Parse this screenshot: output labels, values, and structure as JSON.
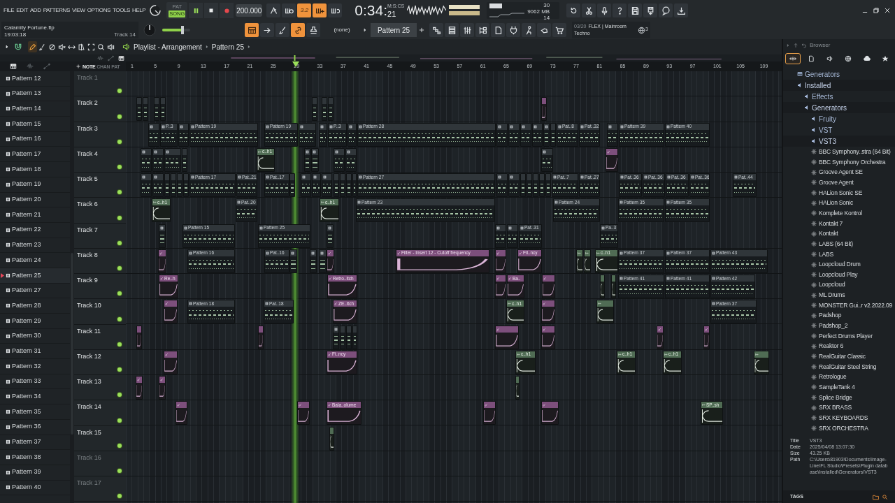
{
  "menu": [
    "FILE",
    "EDIT",
    "ADD",
    "PATTERNS",
    "VIEW",
    "OPTIONS",
    "TOOLS",
    "HELP"
  ],
  "transport": {
    "pattern_label": "PAT",
    "song_label": "SONG",
    "song_mode": true,
    "playing": true,
    "tempo": "200.000",
    "time": "0:34:",
    "centiseconds": "21",
    "time_unit": "M:S:CS"
  },
  "record_options": [
    {
      "kind": "metronome",
      "on": false
    },
    {
      "kind": "wait",
      "on": false
    },
    {
      "kind": "countdown",
      "label": "3.2",
      "on": true
    },
    {
      "kind": "overdub",
      "on": true
    },
    {
      "kind": "loop",
      "on": false
    }
  ],
  "monitor": {
    "cpu": "30",
    "memory": "9062 MB",
    "polyphony": "14"
  },
  "project": {
    "file": "Calamity Fortune.flp",
    "time": "19:03:18",
    "hint": "Track 14"
  },
  "main_volume": {
    "level": 0.72
  },
  "edit_buttons": [
    {
      "kind": "playlist",
      "on": true
    },
    {
      "kind": "arrow",
      "on": false
    },
    {
      "kind": "brush",
      "on": false
    },
    {
      "kind": "link",
      "on": true
    },
    {
      "kind": "stamp",
      "on": false
    }
  ],
  "snap": "(none)",
  "pattern_selector": "Pattern 25",
  "news": {
    "counter": "03/20",
    "title": "FLEX | Mainroom",
    "subtitle": "Techno",
    "badge": "3"
  },
  "playlist_tools": [
    {
      "kind": "pencil",
      "selected": true
    },
    {
      "kind": "brush",
      "selected": false
    },
    {
      "kind": "delete",
      "selected": false
    },
    {
      "kind": "mute",
      "selected": false
    },
    {
      "kind": "slip",
      "selected": false
    },
    {
      "kind": "slice",
      "selected": false
    },
    {
      "kind": "select",
      "selected": false
    },
    {
      "kind": "zoom",
      "selected": false
    },
    {
      "kind": "playback",
      "selected": false
    }
  ],
  "breadcrumb": [
    "Playlist - Arrangement",
    "Pattern 25"
  ],
  "picker": {
    "tabs": [
      {
        "label": "NOTE",
        "selected": true
      },
      {
        "label": "CHAN",
        "selected": false
      },
      {
        "label": "PAT",
        "selected": false
      }
    ],
    "patterns": [
      {
        "name": "Pattern 12",
        "selected": false
      },
      {
        "name": "Pattern 13",
        "selected": false
      },
      {
        "name": "Pattern 14",
        "selected": false
      },
      {
        "name": "Pattern 15",
        "selected": false
      },
      {
        "name": "Pattern 16",
        "selected": false
      },
      {
        "name": "Pattern 17",
        "selected": false
      },
      {
        "name": "Pattern 18",
        "selected": false
      },
      {
        "name": "Pattern 19",
        "selected": false
      },
      {
        "name": "Pattern 20",
        "selected": false
      },
      {
        "name": "Pattern 21",
        "selected": false
      },
      {
        "name": "Pattern 22",
        "selected": false
      },
      {
        "name": "Pattern 23",
        "selected": false
      },
      {
        "name": "Pattern 24",
        "selected": false
      },
      {
        "name": "Pattern 25",
        "selected": true
      },
      {
        "name": "Pattern 27",
        "selected": false
      },
      {
        "name": "Pattern 28",
        "selected": false
      },
      {
        "name": "Pattern 29",
        "selected": false
      },
      {
        "name": "Pattern 30",
        "selected": false
      },
      {
        "name": "Pattern 31",
        "selected": false
      },
      {
        "name": "Pattern 32",
        "selected": false
      },
      {
        "name": "Pattern 33",
        "selected": false
      },
      {
        "name": "Pattern 34",
        "selected": false
      },
      {
        "name": "Pattern 35",
        "selected": false
      },
      {
        "name": "Pattern 36",
        "selected": false
      },
      {
        "name": "Pattern 37",
        "selected": false
      },
      {
        "name": "Pattern 38",
        "selected": false
      },
      {
        "name": "Pattern 39",
        "selected": false
      },
      {
        "name": "Pattern 40",
        "selected": false
      }
    ]
  },
  "ruler": [
    "1",
    "5",
    "9",
    "13",
    "17",
    "21",
    "25",
    "29",
    "33",
    "37",
    "41",
    "45",
    "49",
    "53",
    "57",
    "61",
    "65",
    "69",
    "73",
    "77",
    "81",
    "85",
    "89",
    "93",
    "97",
    "101",
    "105",
    "109"
  ],
  "tracks": [
    {
      "name": "Track 1",
      "empty": true,
      "muted": false
    },
    {
      "name": "Track 2",
      "empty": false,
      "muted": false,
      "clips": [
        {
          "kind": "pattern"
        },
        {
          "kind": "pattern"
        },
        {
          "kind": "pattern"
        },
        {
          "kind": "pattern"
        },
        {
          "kind": "pattern"
        },
        {
          "kind": "pattern"
        },
        {
          "kind": "pattern"
        },
        {
          "kind": "automation"
        }
      ]
    },
    {
      "name": "Track 3",
      "empty": false,
      "muted": false,
      "clips": [
        {
          "kind": "pattern"
        },
        {
          "kind": "pattern",
          "label": "P..3"
        },
        {
          "kind": "pattern"
        },
        {
          "kind": "pattern",
          "label": "Pattern 19"
        },
        {
          "kind": "pattern",
          "label": "Pattern 19"
        },
        {
          "kind": "pattern"
        },
        {
          "kind": "pattern"
        },
        {
          "kind": "pattern",
          "label": "P..3"
        },
        {
          "kind": "pattern"
        },
        {
          "kind": "pattern",
          "label": "Pattern 28"
        },
        {
          "kind": "pattern"
        },
        {
          "kind": "pattern"
        },
        {
          "kind": "pattern"
        },
        {
          "kind": "pattern"
        },
        {
          "kind": "pattern"
        },
        {
          "kind": "pattern"
        },
        {
          "kind": "pattern",
          "label": "Pat..8"
        },
        {
          "kind": "pattern",
          "label": "Pat..32"
        },
        {
          "kind": "pattern"
        },
        {
          "kind": "pattern",
          "label": "Pattern 39"
        },
        {
          "kind": "pattern",
          "label": "Pattern 40"
        }
      ]
    },
    {
      "name": "Track 4",
      "empty": false,
      "muted": false,
      "clips": [
        {
          "kind": "pattern"
        },
        {
          "kind": "pattern"
        },
        {
          "kind": "pattern"
        },
        {
          "kind": "pattern"
        },
        {
          "kind": "audio",
          "label": "c..h1"
        },
        {
          "kind": "pattern"
        },
        {
          "kind": "pattern"
        },
        {
          "kind": "pattern"
        },
        {
          "kind": "pattern"
        },
        {
          "kind": "pattern"
        },
        {
          "kind": "automation"
        }
      ]
    },
    {
      "name": "Track 5",
      "empty": false,
      "muted": false,
      "clips": [
        {
          "kind": "pattern"
        },
        {
          "kind": "pattern"
        },
        {
          "kind": "pattern"
        },
        {
          "kind": "pattern"
        },
        {
          "kind": "pattern"
        },
        {
          "kind": "pattern"
        },
        {
          "kind": "pattern",
          "label": "Pattern 17"
        },
        {
          "kind": "pattern",
          "label": "Pat..21"
        },
        {
          "kind": "pattern",
          "label": "Pat..17"
        },
        {
          "kind": "pattern"
        },
        {
          "kind": "pattern"
        },
        {
          "kind": "pattern"
        },
        {
          "kind": "pattern"
        },
        {
          "kind": "pattern"
        },
        {
          "kind": "pattern"
        },
        {
          "kind": "pattern"
        },
        {
          "kind": "pattern"
        },
        {
          "kind": "pattern",
          "label": "Pattern 27"
        },
        {
          "kind": "pattern"
        },
        {
          "kind": "pattern"
        },
        {
          "kind": "pattern"
        },
        {
          "kind": "pattern"
        },
        {
          "kind": "pattern"
        },
        {
          "kind": "pattern"
        },
        {
          "kind": "pattern"
        },
        {
          "kind": "pattern",
          "label": "Pat..7"
        },
        {
          "kind": "pattern",
          "label": "Pat..27"
        },
        {
          "kind": "pattern",
          "label": "Pat..36"
        },
        {
          "kind": "pattern",
          "label": "Pat..36"
        },
        {
          "kind": "pattern",
          "label": "Pat..36"
        },
        {
          "kind": "pattern",
          "label": "Pat..36"
        },
        {
          "kind": "pattern",
          "label": "Pat..44"
        }
      ]
    },
    {
      "name": "Track 6",
      "empty": false,
      "muted": false,
      "clips": [
        {
          "kind": "audio",
          "label": "c..h1"
        },
        {
          "kind": "pattern",
          "label": "Pat..20"
        },
        {
          "kind": "audio",
          "label": "c..h1"
        },
        {
          "kind": "pattern",
          "label": "Pattern 23"
        },
        {
          "kind": "pattern",
          "label": "Pattern 24"
        },
        {
          "kind": "pattern",
          "label": "Pattern 35"
        },
        {
          "kind": "pattern",
          "label": "Pattern 35"
        }
      ]
    },
    {
      "name": "Track 7",
      "empty": false,
      "muted": false,
      "clips": [
        {
          "kind": "pattern"
        },
        {
          "kind": "pattern",
          "label": "Pattern 15"
        },
        {
          "kind": "pattern",
          "label": "Pattern 25"
        },
        {
          "kind": "pattern"
        },
        {
          "kind": "pattern"
        },
        {
          "kind": "pattern"
        },
        {
          "kind": "pattern",
          "label": "Pat..31"
        },
        {
          "kind": "pattern",
          "label": "Pa..3"
        }
      ]
    },
    {
      "name": "Track 8",
      "empty": false,
      "muted": false,
      "clips": [
        {
          "kind": "automation"
        },
        {
          "kind": "pattern",
          "label": "Pattern 16"
        },
        {
          "kind": "pattern",
          "label": "Pat..16"
        },
        {
          "kind": "pattern"
        },
        {
          "kind": "pattern"
        },
        {
          "kind": "pattern"
        },
        {
          "kind": "automation"
        },
        {
          "kind": "automation",
          "label": "Filter - Insert 12 - Cutoff frequency"
        },
        {
          "kind": "automation"
        },
        {
          "kind": "automation",
          "label": "Fil..ncy"
        },
        {
          "kind": "audio"
        },
        {
          "kind": "audio"
        },
        {
          "kind": "audio",
          "label": "c..h1"
        },
        {
          "kind": "pattern",
          "label": "Pattern 37"
        },
        {
          "kind": "pattern",
          "label": "Pattern 37"
        },
        {
          "kind": "pattern",
          "label": "Pattern 43"
        }
      ]
    },
    {
      "name": "Track 9",
      "empty": false,
      "muted": false,
      "clips": [
        {
          "kind": "automation",
          "label": "Re..h"
        },
        {
          "kind": "automation",
          "label": "Retro..itch"
        },
        {
          "kind": "automation"
        },
        {
          "kind": "automation",
          "label": "Ba.."
        },
        {
          "kind": "automation"
        },
        {
          "kind": "audio"
        },
        {
          "kind": "audio"
        },
        {
          "kind": "pattern",
          "label": "Pattern 41"
        },
        {
          "kind": "pattern",
          "label": "Pattern 41"
        },
        {
          "kind": "pattern",
          "label": "Pattern 42"
        }
      ]
    },
    {
      "name": "Track 10",
      "empty": false,
      "muted": false,
      "clips": [
        {
          "kind": "automation"
        },
        {
          "kind": "pattern",
          "label": "Pattern 18"
        },
        {
          "kind": "pattern",
          "label": "Pat..18"
        },
        {
          "kind": "automation",
          "label": "ZE..itch"
        },
        {
          "kind": "audio",
          "label": "c..h1"
        },
        {
          "kind": "automation"
        },
        {
          "kind": "audio"
        },
        {
          "kind": "pattern",
          "label": "Pattern 37"
        }
      ]
    },
    {
      "name": "Track 11",
      "empty": false,
      "muted": false,
      "clips": [
        {
          "kind": "automation"
        },
        {
          "kind": "automation"
        },
        {
          "kind": "pattern"
        },
        {
          "kind": "pattern"
        },
        {
          "kind": "pattern"
        },
        {
          "kind": "pattern"
        },
        {
          "kind": "automation"
        },
        {
          "kind": "automation"
        },
        {
          "kind": "automation"
        },
        {
          "kind": "automation"
        }
      ]
    },
    {
      "name": "Track 12",
      "empty": false,
      "muted": false,
      "clips": [
        {
          "kind": "automation"
        },
        {
          "kind": "automation",
          "label": "Fi..ncy"
        },
        {
          "kind": "audio",
          "label": "c..h1"
        },
        {
          "kind": "audio",
          "label": "c..h1"
        },
        {
          "kind": "audio",
          "label": "c..h1"
        },
        {
          "kind": "audio"
        }
      ]
    },
    {
      "name": "Track 13",
      "empty": false,
      "muted": false,
      "clips": [
        {
          "kind": "automation"
        },
        {
          "kind": "automation"
        },
        {
          "kind": "audio"
        }
      ]
    },
    {
      "name": "Track 14",
      "empty": false,
      "muted": false,
      "clips": [
        {
          "kind": "automation"
        },
        {
          "kind": "automation"
        },
        {
          "kind": "automation",
          "label": "Bala..olume"
        },
        {
          "kind": "automation"
        },
        {
          "kind": "automation"
        },
        {
          "kind": "audio",
          "label": "SP..sh"
        }
      ]
    },
    {
      "name": "Track 15",
      "empty": false,
      "muted": false,
      "clips": [
        {
          "kind": "audio"
        }
      ]
    },
    {
      "name": "Track 16",
      "empty": true,
      "muted": false
    },
    {
      "name": "Track 17",
      "empty": true,
      "muted": false
    }
  ],
  "browser": {
    "title": "Browser",
    "tabs": [
      {
        "kind": "all",
        "selected": true
      },
      {
        "kind": "files",
        "selected": false
      },
      {
        "kind": "plugins",
        "selected": false
      },
      {
        "kind": "online",
        "selected": false
      },
      {
        "kind": "cloud",
        "selected": false
      },
      {
        "kind": "favorites",
        "selected": false
      }
    ],
    "tree": [
      {
        "label": "Generators",
        "kind": "category"
      },
      {
        "label": "Installed",
        "kind": "folder",
        "children": [
          {
            "label": "Effects",
            "kind": "folder"
          },
          {
            "label": "Generators",
            "kind": "folder",
            "children": [
              {
                "label": "Fruity",
                "kind": "folder"
              },
              {
                "label": "VST",
                "kind": "folder"
              },
              {
                "label": "VST3",
                "kind": "folder",
                "children": [
                  {
                    "label": "BBC Symphony..stra (64 Bit)",
                    "kind": "plugin"
                  },
                  {
                    "label": "BBC Symphony Orchestra",
                    "kind": "plugin"
                  },
                  {
                    "label": "Groove Agent SE",
                    "kind": "plugin"
                  },
                  {
                    "label": "Groove Agent",
                    "kind": "plugin"
                  },
                  {
                    "label": "HALion Sonic SE",
                    "kind": "plugin"
                  },
                  {
                    "label": "HALion Sonic",
                    "kind": "plugin"
                  },
                  {
                    "label": "Komplete Kontrol",
                    "kind": "plugin"
                  },
                  {
                    "label": "Kontakt 7",
                    "kind": "plugin"
                  },
                  {
                    "label": "Kontakt",
                    "kind": "plugin"
                  },
                  {
                    "label": "LABS (64 Bit)",
                    "kind": "plugin"
                  },
                  {
                    "label": "LABS",
                    "kind": "plugin"
                  },
                  {
                    "label": "Loopcloud Drum",
                    "kind": "plugin"
                  },
                  {
                    "label": "Loopcloud Play",
                    "kind": "plugin"
                  },
                  {
                    "label": "Loopcloud",
                    "kind": "plugin"
                  },
                  {
                    "label": "ML Drums",
                    "kind": "plugin"
                  },
                  {
                    "label": "MONSTER Gui..r v2.2022.09",
                    "kind": "plugin"
                  },
                  {
                    "label": "Padshop",
                    "kind": "plugin"
                  },
                  {
                    "label": "Padshop_2",
                    "kind": "plugin"
                  },
                  {
                    "label": "Perfect Drums Player",
                    "kind": "plugin"
                  },
                  {
                    "label": "Reaktor 6",
                    "kind": "plugin"
                  },
                  {
                    "label": "RealGuitar Classic",
                    "kind": "plugin"
                  },
                  {
                    "label": "RealGuitar Steel String",
                    "kind": "plugin"
                  },
                  {
                    "label": "Retrologue",
                    "kind": "plugin"
                  },
                  {
                    "label": "SampleTank 4",
                    "kind": "plugin"
                  },
                  {
                    "label": "Splice Bridge",
                    "kind": "plugin"
                  },
                  {
                    "label": "SRX BRASS",
                    "kind": "plugin"
                  },
                  {
                    "label": "SRX KEYBOARDS",
                    "kind": "plugin"
                  },
                  {
                    "label": "SRX ORCHESTRA",
                    "kind": "plugin"
                  }
                ]
              }
            ]
          }
        ]
      }
    ],
    "info": [
      {
        "label": "Title",
        "value": "VST3"
      },
      {
        "label": "Date",
        "value": "2025/04/08 13:07:30"
      },
      {
        "label": "Size",
        "value": "43.25 KB"
      },
      {
        "label": "Path",
        "value": "C:\\Users\\81903\\Documents\\Image-Line\\FL Studio\\Presets\\Plugin database\\Installed\\Generators\\VST3"
      }
    ],
    "tags_label": "TAGS"
  }
}
